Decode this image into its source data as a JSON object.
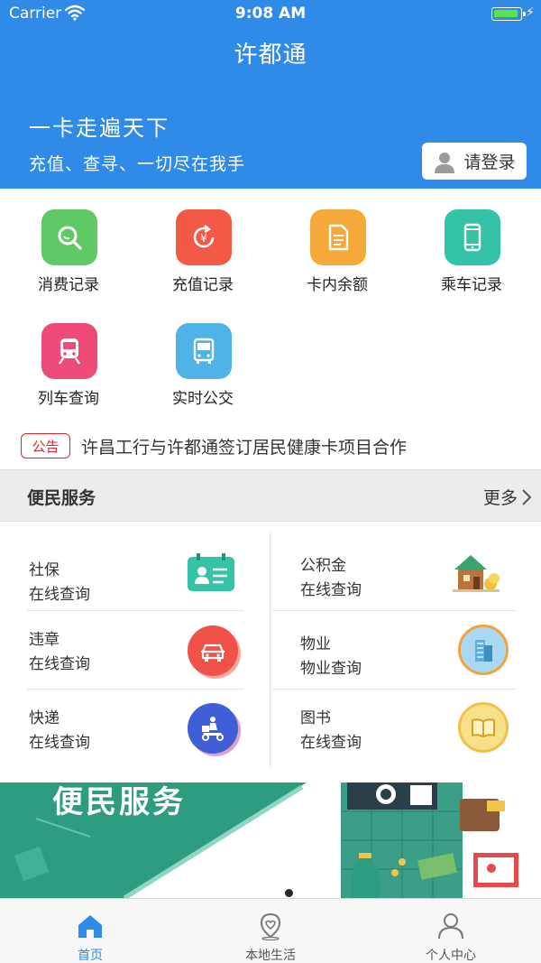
{
  "status_bar": {
    "carrier": "Carrier",
    "time": "9:08 AM"
  },
  "header": {
    "title": "许都通",
    "hero_title": "一卡走遍天下",
    "hero_subtitle": "充值、查寻、一切尽在我手",
    "login_label": "请登录"
  },
  "grid": {
    "items": [
      {
        "label": "消费记录",
        "color": "#5fc966",
        "icon": "search-icon"
      },
      {
        "label": "充值记录",
        "color": "#f25a47",
        "icon": "yen-refresh-icon"
      },
      {
        "label": "卡内余额",
        "color": "#f6a93b",
        "icon": "document-icon"
      },
      {
        "label": "乘车记录",
        "color": "#35c3a7",
        "icon": "phone-icon"
      },
      {
        "label": "列车查询",
        "color": "#ef4b78",
        "icon": "train-icon"
      },
      {
        "label": "实时公交",
        "color": "#4fb3e8",
        "icon": "bus-icon"
      }
    ]
  },
  "notice": {
    "tag": "公告",
    "text": "许昌工行与许都通签订居民健康卡项目合作"
  },
  "section": {
    "title": "便民服务",
    "more": "更多"
  },
  "services": [
    {
      "line1": "社保",
      "line2": "在线查询",
      "icon": "id-card-icon"
    },
    {
      "line1": "公积金",
      "line2": "在线查询",
      "icon": "house-coins-icon"
    },
    {
      "line1": "违章",
      "line2": "在线查询",
      "icon": "car-icon"
    },
    {
      "line1": "物业",
      "line2": "物业查询",
      "icon": "building-icon"
    },
    {
      "line1": "快递",
      "line2": "在线查询",
      "icon": "delivery-scooter-icon"
    },
    {
      "line1": "图书",
      "line2": "在线查询",
      "icon": "book-icon"
    }
  ],
  "banner": {
    "text": "便民服务"
  },
  "tabs": [
    {
      "label": "首页",
      "icon": "home-icon",
      "active": true
    },
    {
      "label": "本地生活",
      "icon": "location-pin-icon",
      "active": false
    },
    {
      "label": "个人中心",
      "icon": "person-icon",
      "active": false
    }
  ],
  "colors": {
    "brand": "#2f8ae8",
    "notice_red": "#e3262b",
    "banner_green": "#2d9c7f"
  }
}
